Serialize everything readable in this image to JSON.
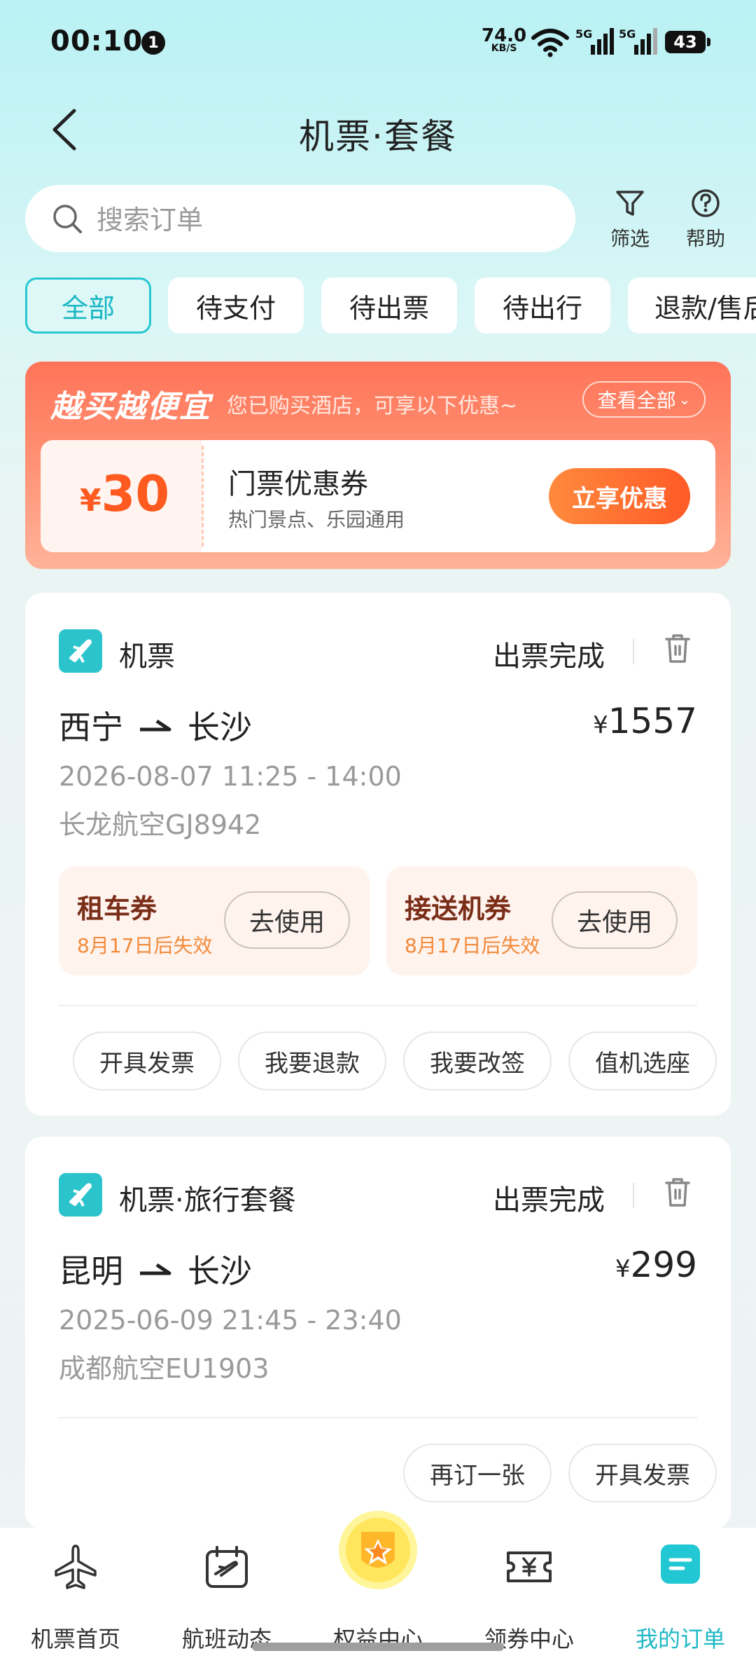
{
  "status_bar": {
    "time": "00:10",
    "notification_count": "1",
    "net_speed": "74.0",
    "net_speed_unit": "KB/S",
    "signal1": "5G",
    "signal2": "5G",
    "battery": "43"
  },
  "header": {
    "title": "机票·套餐"
  },
  "search": {
    "placeholder": "搜索订单"
  },
  "tools": {
    "filter_label": "筛选",
    "help_label": "帮助"
  },
  "tabs": [
    {
      "label": "全部",
      "active": true
    },
    {
      "label": "待支付"
    },
    {
      "label": "待出票"
    },
    {
      "label": "待出行"
    },
    {
      "label": "退款/售后"
    }
  ],
  "promo": {
    "title": "越买越便宜",
    "subtitle": "您已购买酒店，可享以下优惠~",
    "view_all": "查看全部",
    "coupon": {
      "currency": "¥",
      "amount": "30",
      "name": "门票优惠券",
      "desc": "热门景点、乐园通用",
      "button": "立享优惠"
    }
  },
  "orders": [
    {
      "category": "机票",
      "status": "出票完成",
      "from": "西宁",
      "to": "长沙",
      "currency": "¥",
      "price": "1557",
      "datetime": "2026-08-07 11:25 - 14:00",
      "flight": "长龙航空GJ8942",
      "vouchers": [
        {
          "name": "租车券",
          "expiry": "8月17日后失效",
          "button": "去使用"
        },
        {
          "name": "接送机券",
          "expiry": "8月17日后失效",
          "button": "去使用"
        }
      ],
      "actions": [
        "开具发票",
        "我要退款",
        "我要改签",
        "值机选座"
      ]
    },
    {
      "category": "机票·旅行套餐",
      "status": "出票完成",
      "from": "昆明",
      "to": "长沙",
      "currency": "¥",
      "price": "299",
      "datetime": "2025-06-09 21:45 - 23:40",
      "flight": "成都航空EU1903",
      "actions": [
        "再订一张",
        "开具发票"
      ]
    }
  ],
  "bottom_nav": [
    {
      "label": "机票首页",
      "icon": "plane-icon"
    },
    {
      "label": "航班动态",
      "icon": "flight-calendar-icon"
    },
    {
      "label": "权益中心",
      "icon": "star-badge-icon"
    },
    {
      "label": "领券中心",
      "icon": "coupon-icon"
    },
    {
      "label": "我的订单",
      "icon": "orders-icon",
      "active": true
    }
  ],
  "colors": {
    "accent": "#1fb8c6",
    "promo": "#ff7459",
    "price_orange": "#ff5a1f"
  }
}
